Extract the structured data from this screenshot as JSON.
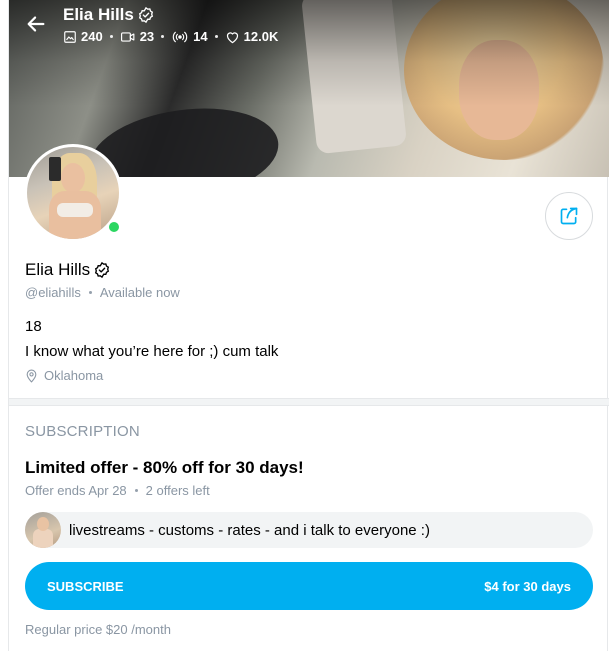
{
  "header": {
    "name": "Elia Hills",
    "stats": {
      "photos": "240",
      "videos": "23",
      "streams": "14",
      "likes": "12.0K"
    }
  },
  "profile": {
    "name": "Elia Hills",
    "handle": "@eliahills",
    "status": "Available now",
    "bio_line1": "18",
    "bio_line2": "I know what you’re here for ;) cum talk",
    "location": "Oklahoma"
  },
  "subscription": {
    "heading": "SUBSCRIPTION",
    "offer_title": "Limited offer - 80% off for 30 days!",
    "offer_ends": "Offer ends Apr 28",
    "offers_left": "2 offers left",
    "promo_message": "livestreams - customs - rates - and i talk to everyone :)",
    "button_label": "SUBSCRIBE",
    "button_price": "$4 for 30 days",
    "regular_price": "Regular price $20 /month"
  },
  "colors": {
    "accent": "#00aff0",
    "online": "#2bd661",
    "muted_text": "#8a96a3"
  },
  "icons": [
    "back-arrow-icon",
    "verified-icon",
    "image-icon",
    "video-icon",
    "broadcast-icon",
    "heart-icon",
    "share-icon",
    "location-pin-icon"
  ]
}
